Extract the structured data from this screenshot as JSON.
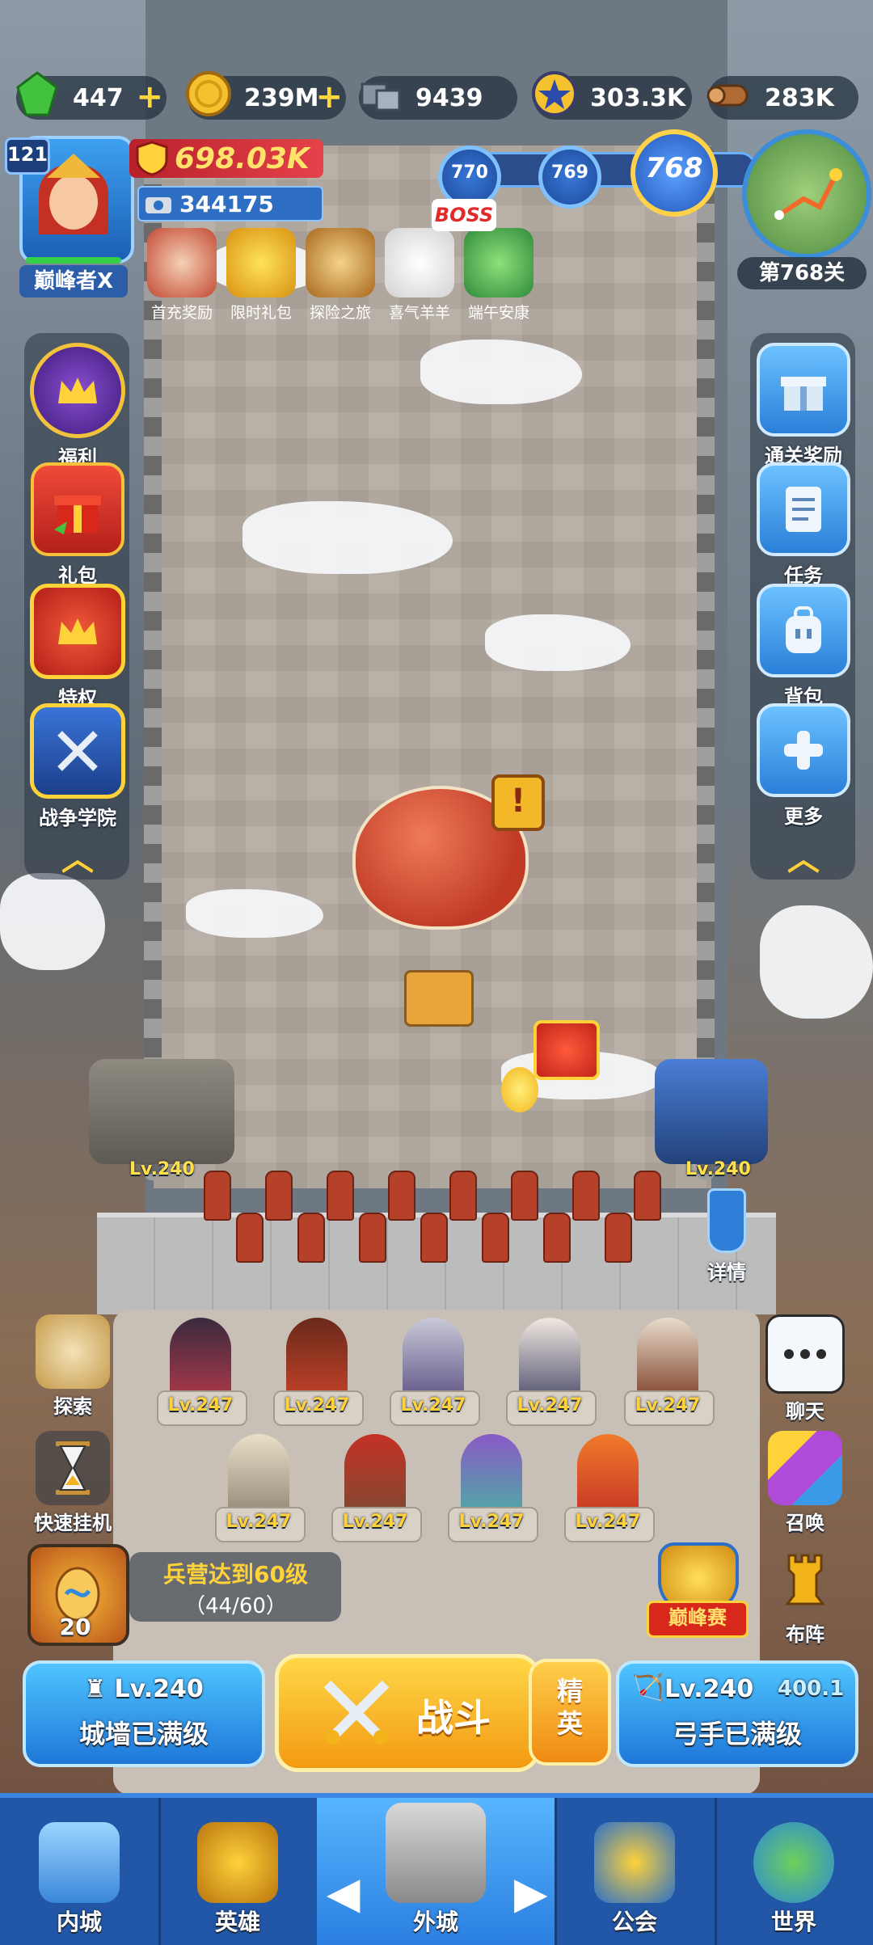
{
  "resources": {
    "gems": "447",
    "gold": "239M",
    "stone": "9439",
    "medals": "303.3K",
    "wood": "283K"
  },
  "player": {
    "level": "121",
    "name": "巅峰者X",
    "power": "698.03K",
    "sub_power": "344175"
  },
  "events": [
    {
      "label": "首充奖励"
    },
    {
      "label": "限时礼包"
    },
    {
      "label": "探险之旅"
    },
    {
      "label": "喜气羊羊"
    },
    {
      "label": "端午安康"
    }
  ],
  "stage": {
    "node_a": "770",
    "node_b": "769",
    "current": "768",
    "boss": "BOSS",
    "label": "第768关"
  },
  "left_menu": [
    {
      "label": "福利"
    },
    {
      "label": "礼包"
    },
    {
      "label": "特权"
    },
    {
      "label": "战争学院"
    }
  ],
  "right_menu": [
    {
      "label": "通关奖励"
    },
    {
      "label": "任务"
    },
    {
      "label": "背包"
    },
    {
      "label": "更多"
    }
  ],
  "alert": "!",
  "towers": {
    "left_level": "Lv.240",
    "right_level": "Lv.240",
    "detail_label": "详情"
  },
  "heroes": [
    {
      "level": "Lv.247"
    },
    {
      "level": "Lv.247"
    },
    {
      "level": "Lv.247"
    },
    {
      "level": "Lv.247"
    },
    {
      "level": "Lv.247"
    },
    {
      "level": "Lv.247"
    },
    {
      "level": "Lv.247"
    },
    {
      "level": "Lv.247"
    },
    {
      "level": "Lv.247"
    }
  ],
  "lower_left": [
    {
      "label": "探索"
    },
    {
      "label": "快速挂机"
    }
  ],
  "lower_right": [
    {
      "label": "聊天"
    },
    {
      "label": "召唤"
    },
    {
      "label": "布阵"
    }
  ],
  "peak_event": "巅峰赛",
  "barracks": {
    "title": "兵营达到60级",
    "progress": "（44/60）",
    "egg_count": "20"
  },
  "actions": {
    "wall_level": "Lv.240",
    "wall_status": "城墙已满级",
    "fight": "战斗",
    "elite": "精英",
    "archer_level": "Lv.240",
    "archer_power": "400.1",
    "archer_status": "弓手已满级"
  },
  "nav": [
    {
      "label": "内城"
    },
    {
      "label": "英雄"
    },
    {
      "label": "外城"
    },
    {
      "label": "公会"
    },
    {
      "label": "世界"
    }
  ],
  "colors": {
    "accent_blue": "#2a7fe0",
    "accent_gold": "#ffd23a",
    "power_red": "#c03a25"
  }
}
